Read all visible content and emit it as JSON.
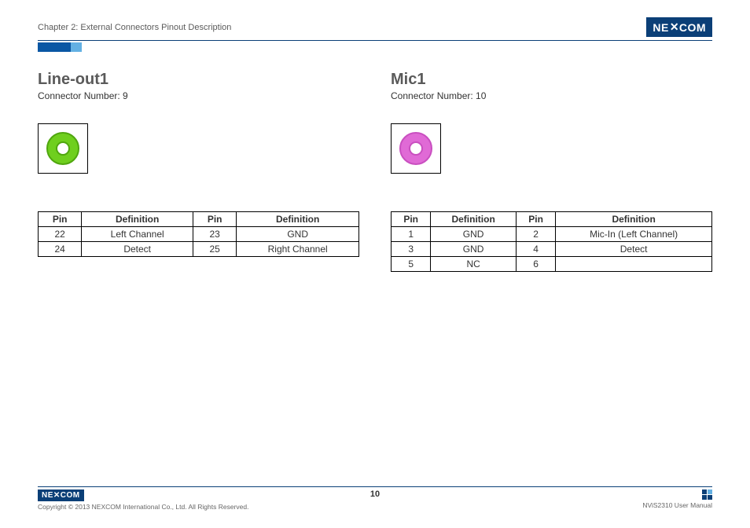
{
  "header": {
    "chapter": "Chapter 2: External Connectors Pinout Description",
    "brand": "NEXCOM"
  },
  "columns": [
    {
      "title": "Line-out1",
      "subtitle": "Connector Number: 9",
      "jack_color": "green",
      "headers": [
        "Pin",
        "Definition",
        "Pin",
        "Definition"
      ],
      "rows": [
        [
          "22",
          "Left Channel",
          "23",
          "GND"
        ],
        [
          "24",
          "Detect",
          "25",
          "Right Channel"
        ]
      ]
    },
    {
      "title": "Mic1",
      "subtitle": "Connector Number: 10",
      "jack_color": "pink",
      "headers": [
        "Pin",
        "Definition",
        "Pin",
        "Definition"
      ],
      "rows": [
        [
          "1",
          "GND",
          "2",
          "Mic-In (Left Channel)"
        ],
        [
          "3",
          "GND",
          "4",
          "Detect"
        ],
        [
          "5",
          "NC",
          "6",
          ""
        ]
      ]
    }
  ],
  "footer": {
    "copyright": "Copyright © 2013 NEXCOM International Co., Ltd. All Rights Reserved.",
    "page": "10",
    "manual": "NViS2310 User Manual",
    "brand": "NEXCOM"
  }
}
